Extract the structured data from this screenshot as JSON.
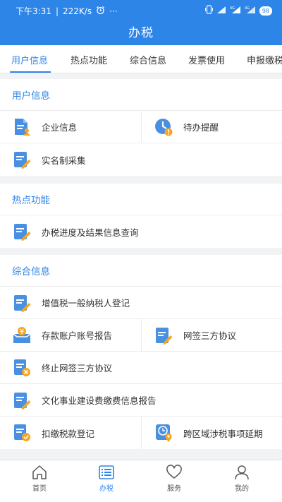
{
  "status": {
    "time": "下午3:31",
    "speed": "222K/s",
    "more": "···",
    "battery": "98"
  },
  "title": "办税",
  "tabs": [
    {
      "label": "用户信息",
      "active": true
    },
    {
      "label": "热点功能"
    },
    {
      "label": "综合信息"
    },
    {
      "label": "发票使用"
    },
    {
      "label": "申报缴税"
    }
  ],
  "sections": {
    "user": {
      "title": "用户信息",
      "items": {
        "company": "企业信息",
        "todo": "待办提醒",
        "realname": "实名制采集"
      }
    },
    "hot": {
      "title": "热点功能",
      "items": {
        "progress": "办税进度及结果信息查询"
      }
    },
    "general": {
      "title": "综合信息",
      "items": {
        "vat": "增值税一般纳税人登记",
        "deposit": "存款账户账号报告",
        "netsign": "网签三方协议",
        "terminate": "终止网签三方协议",
        "culture": "文化事业建设费缴费信息报告",
        "withhold": "扣缴税款登记",
        "crossregion": "跨区域涉税事项延期"
      }
    }
  },
  "nav": [
    {
      "label": "首页",
      "icon": "home-icon"
    },
    {
      "label": "办税",
      "icon": "list-icon",
      "active": true
    },
    {
      "label": "服务",
      "icon": "heart-icon"
    },
    {
      "label": "我的",
      "icon": "user-icon"
    }
  ],
  "colors": {
    "primary": "#2e85e8",
    "icon_orange": "#f5a623",
    "icon_blue": "#4a90e2"
  }
}
